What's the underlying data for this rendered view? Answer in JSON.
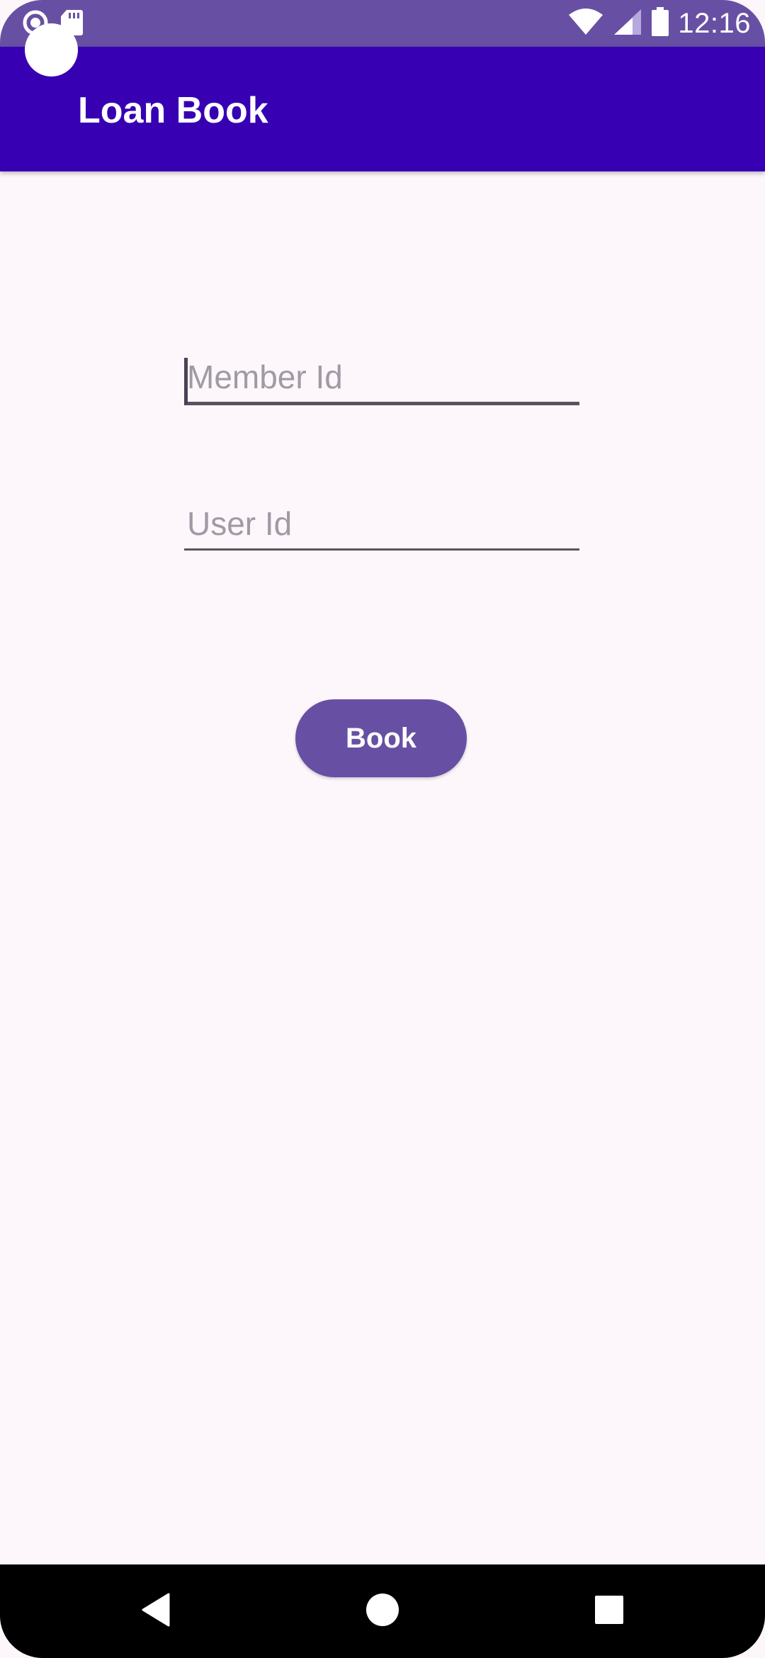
{
  "status_bar": {
    "time": "12:16",
    "icons": [
      "sync-icon",
      "sd-card-icon",
      "wifi-icon",
      "signal-icon",
      "battery-icon"
    ]
  },
  "app_bar": {
    "title": "Loan Book"
  },
  "form": {
    "member_id": {
      "value": "",
      "placeholder": "Member Id"
    },
    "user_id": {
      "value": "",
      "placeholder": "User Id"
    },
    "book_button_label": "Book"
  },
  "nav_bar": {
    "buttons": [
      "back-icon",
      "home-icon",
      "recents-icon"
    ]
  },
  "colors": {
    "status_bar": "#6750a4",
    "app_bar": "#3700b3",
    "background": "#fdf7fc",
    "button": "#6750a4",
    "nav_bar": "#000000"
  }
}
